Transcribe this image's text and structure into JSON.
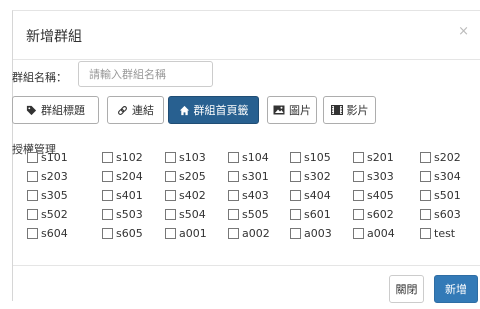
{
  "modal": {
    "title": "新增群組",
    "close_glyph": "×"
  },
  "form": {
    "name_label": "群組名稱：",
    "name_placeholder": "請輸入群組名稱",
    "tabs": [
      {
        "label": "群組標題",
        "icon": "tag-icon",
        "active": false
      },
      {
        "label": "連結",
        "icon": "link-icon",
        "active": false
      },
      {
        "label": "群組首頁籤",
        "icon": "home-icon",
        "active": true
      },
      {
        "label": "圖片",
        "icon": "image-icon",
        "active": false
      },
      {
        "label": "影片",
        "icon": "film-icon",
        "active": false
      }
    ],
    "permissions_label": "授權管理",
    "permissions": [
      [
        "s101",
        "s102",
        "s103",
        "s104",
        "s105",
        "s201",
        "s202"
      ],
      [
        "s203",
        "s204",
        "s205",
        "s301",
        "s302",
        "s303",
        "s304"
      ],
      [
        "s305",
        "s401",
        "s402",
        "s403",
        "s404",
        "s405",
        "s501"
      ],
      [
        "s502",
        "s503",
        "s504",
        "s505",
        "s601",
        "s602",
        "s603"
      ],
      [
        "s604",
        "s605",
        "a001",
        "a002",
        "a003",
        "a004",
        "test"
      ]
    ]
  },
  "footer": {
    "close_label": "關閉",
    "add_label": "新增"
  },
  "colors": {
    "primary": "#337ab7",
    "active_tab": "#286090"
  }
}
